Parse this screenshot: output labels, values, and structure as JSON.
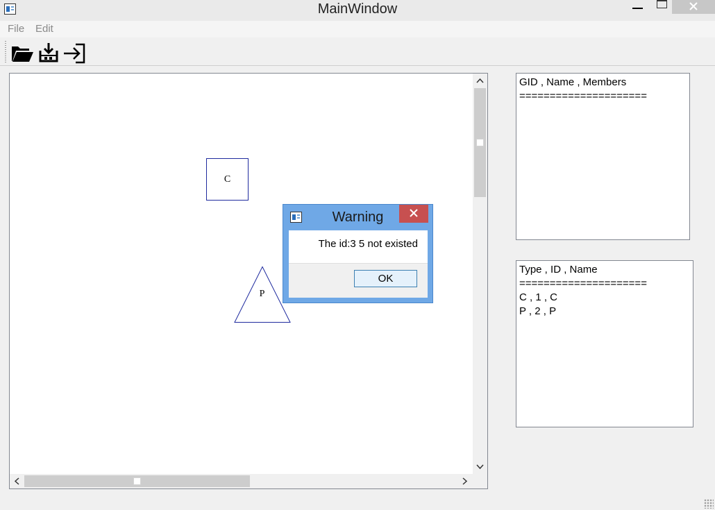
{
  "window": {
    "title": "MainWindow"
  },
  "menu": {
    "file": "File",
    "edit": "Edit"
  },
  "toolbar": {
    "items": [
      "folder-open-icon",
      "save-disk-icon",
      "exit-arrow-icon"
    ]
  },
  "canvas": {
    "shapes": [
      {
        "type": "square",
        "label": "C"
      },
      {
        "type": "triangle",
        "label": "P"
      }
    ]
  },
  "groups_panel": {
    "header": "GID , Name , Members",
    "separator": "=====================",
    "rows": []
  },
  "objects_panel": {
    "header": "Type , ID , Name",
    "separator": "=====================",
    "rows": [
      "C , 1 , C",
      "P , 2 , P"
    ]
  },
  "dialog": {
    "title": "Warning",
    "message": "The id:3 5 not existed",
    "ok_label": "OK"
  },
  "colors": {
    "dialog_frame": "#6fa8e6",
    "dialog_close": "#c75050",
    "shape_stroke": "#1e2a9e"
  }
}
